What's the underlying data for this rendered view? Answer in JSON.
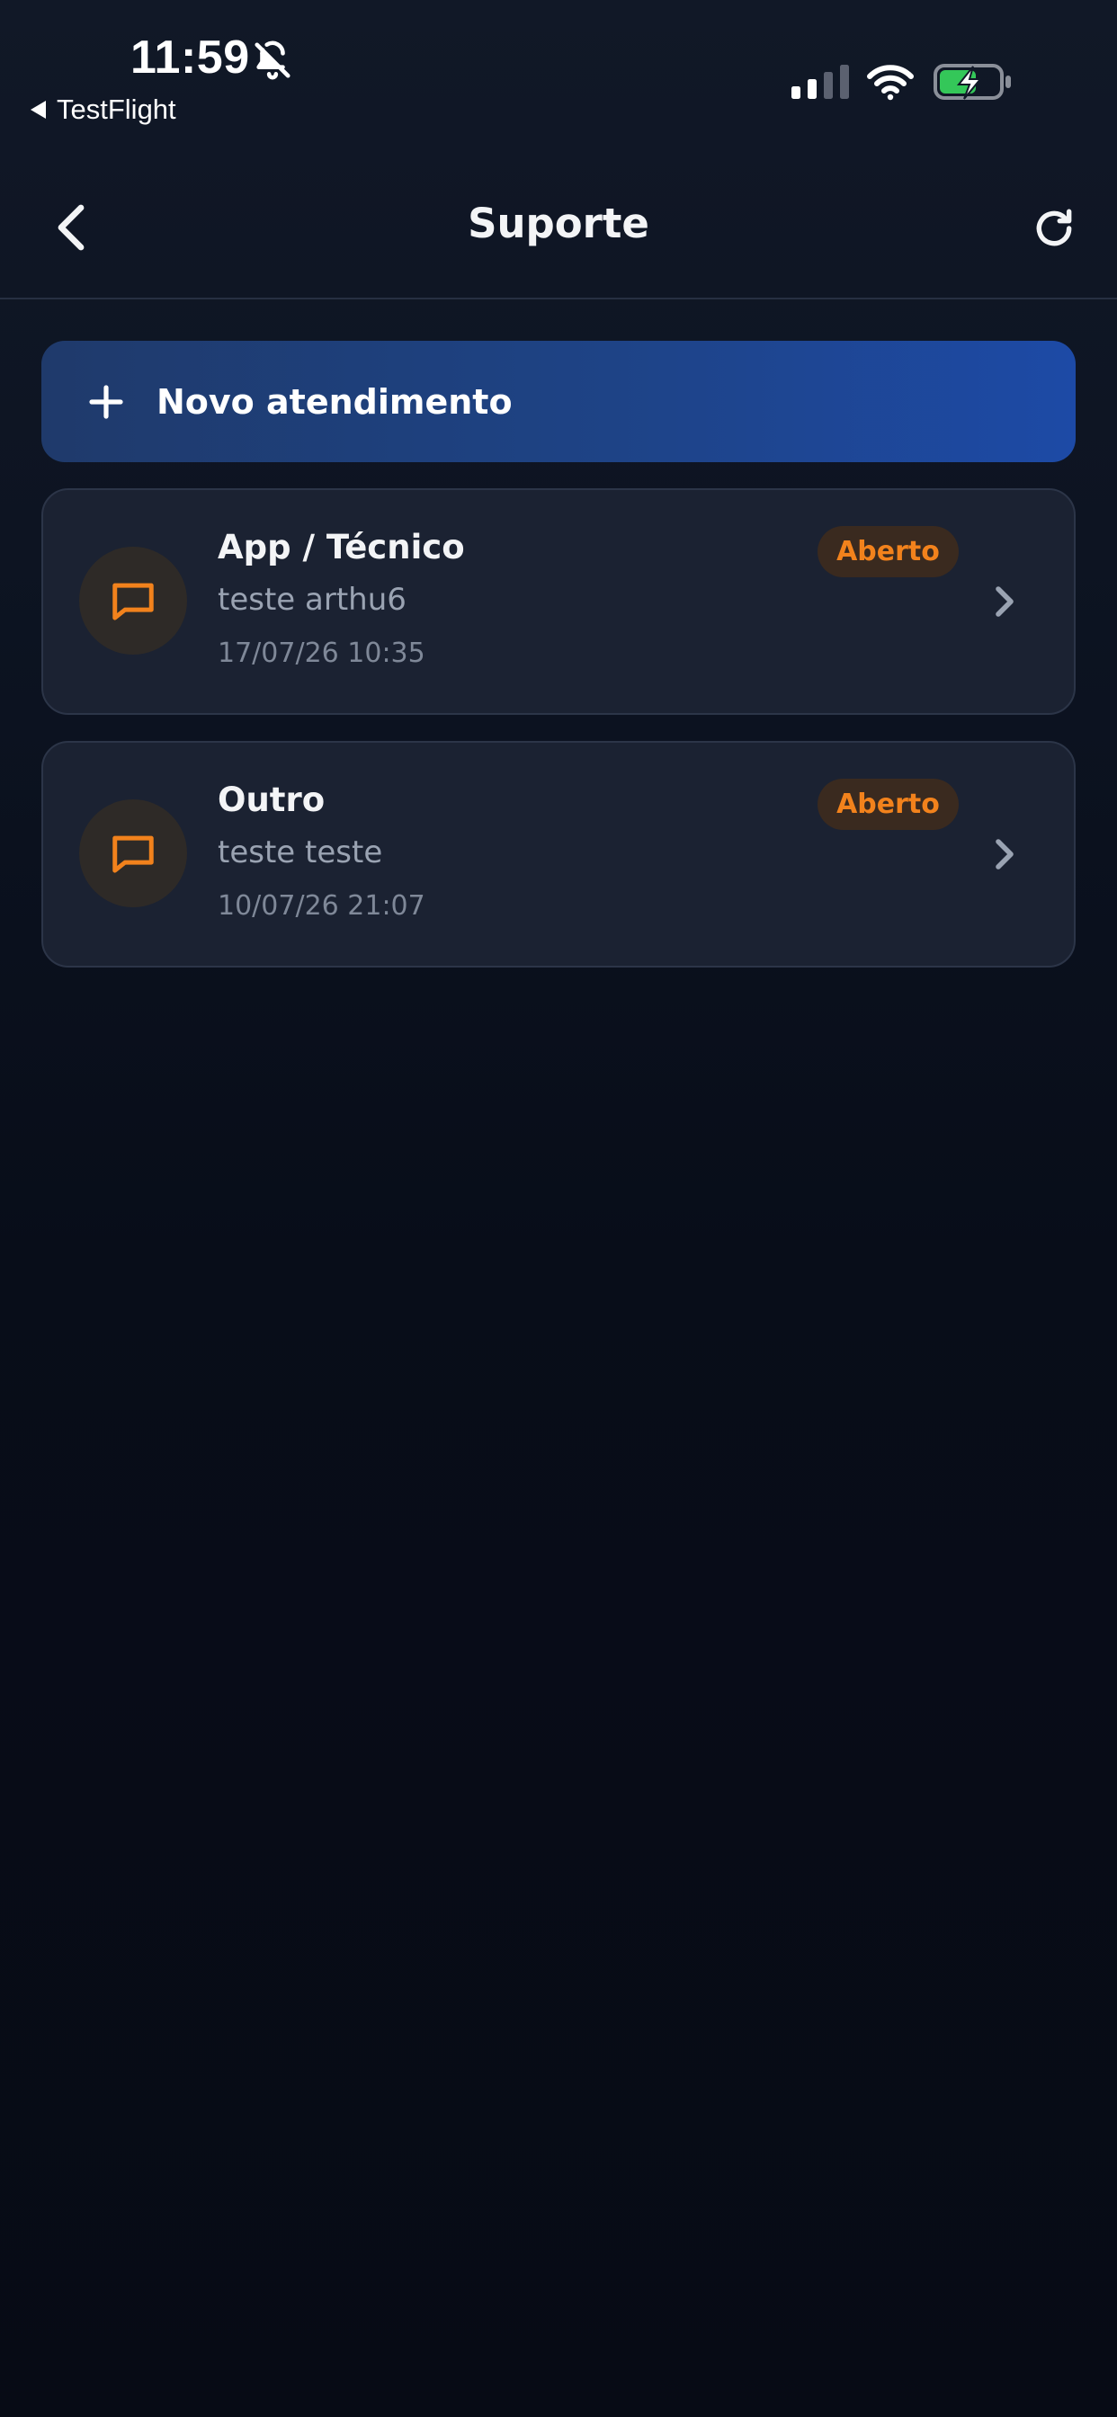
{
  "status_bar": {
    "time": "11:59",
    "back_app": "TestFlight"
  },
  "header": {
    "title": "Suporte"
  },
  "actions": {
    "new_ticket_label": "Novo atendimento"
  },
  "tickets": [
    {
      "category": "App / Técnico",
      "subject": "teste arthu6",
      "date": "17/07/26 10:35",
      "status": "Aberto"
    },
    {
      "category": "Outro",
      "subject": "teste teste",
      "date": "10/07/26 21:07",
      "status": "Aberto"
    }
  ],
  "colors": {
    "background": "#0b1120",
    "card": "#1b2232",
    "accent_blue": "#1d4aa6",
    "status_orange": "#f2821c"
  },
  "icons": {
    "back": "chevron-left-icon",
    "refresh": "refresh-icon",
    "add": "plus-icon",
    "ticket": "message-square-icon",
    "open_ticket": "chevron-right-icon",
    "silent": "bell-off-icon"
  }
}
